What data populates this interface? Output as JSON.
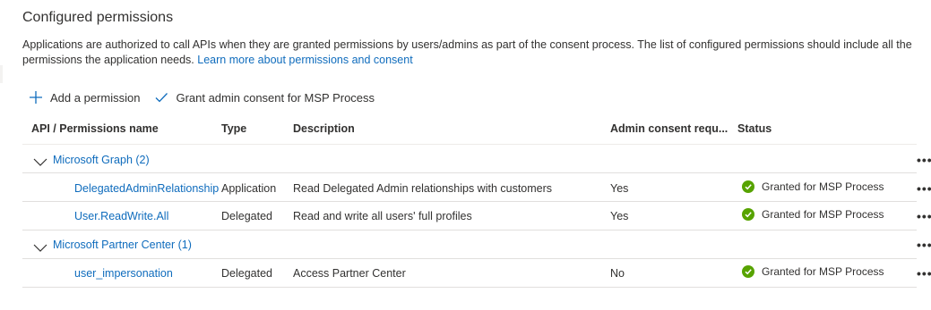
{
  "section": {
    "title": "Configured permissions",
    "description": "Applications are authorized to call APIs when they are granted permissions by users/admins as part of the consent process. The list of configured permissions should include all the permissions the application needs.",
    "learn_more_link": "Learn more about permissions and consent"
  },
  "commands": {
    "add_permission": "Add a permission",
    "grant_consent": "Grant admin consent for MSP Process"
  },
  "table": {
    "columns": {
      "api": "API / Permissions name",
      "type": "Type",
      "description": "Description",
      "admin_consent": "Admin consent requ...",
      "status": "Status"
    },
    "groups": [
      {
        "label": "Microsoft Graph (2)",
        "rows": [
          {
            "name": "DelegatedAdminRelationship",
            "type": "Application",
            "description": "Read Delegated Admin relationships with customers",
            "admin_consent": "Yes",
            "status": "Granted for MSP Process"
          },
          {
            "name": "User.ReadWrite.All",
            "type": "Delegated",
            "description": "Read and write all users' full profiles",
            "admin_consent": "Yes",
            "status": "Granted for MSP Process"
          }
        ]
      },
      {
        "label": "Microsoft Partner Center (1)",
        "rows": [
          {
            "name": "user_impersonation",
            "type": "Delegated",
            "description": "Access Partner Center",
            "admin_consent": "No",
            "status": "Granted for MSP Process"
          }
        ]
      }
    ],
    "more_glyph": "•••"
  },
  "colors": {
    "link": "#0f6cbd",
    "granted": "#57a300",
    "divider": "#e1dfdd"
  }
}
